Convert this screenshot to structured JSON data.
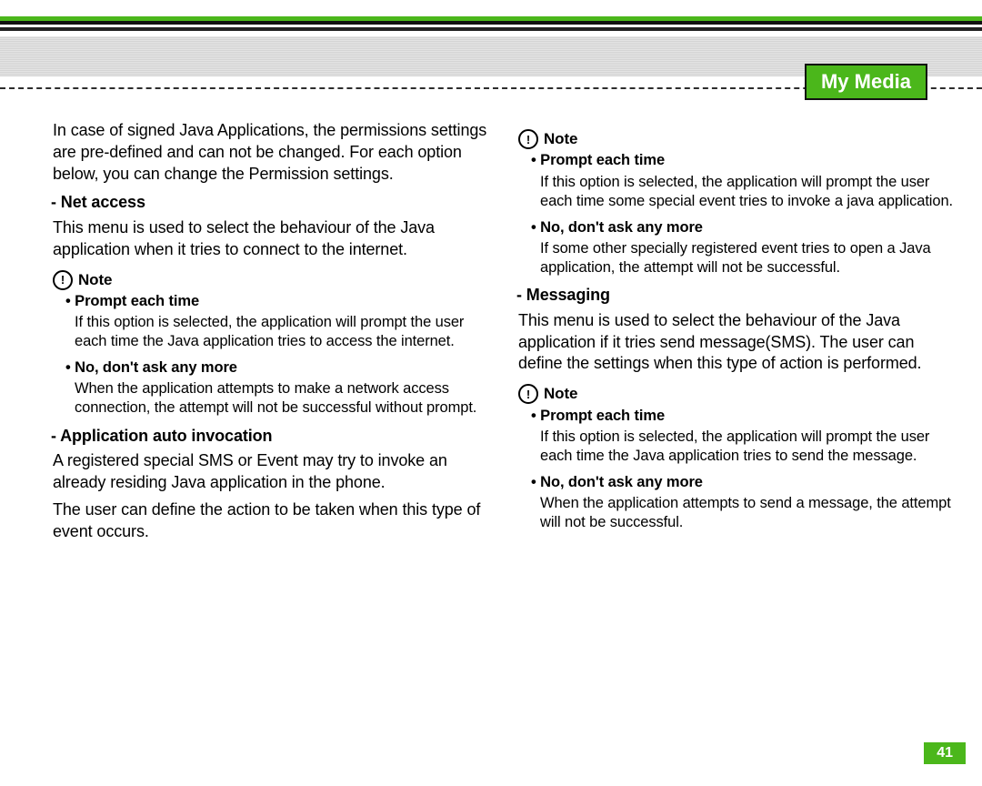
{
  "chapter": "My Media",
  "page_number": "41",
  "intro": "In case of signed Java Applications, the permissions settings are pre-defined and can not be changed. For each option below, you can change the Permission settings.",
  "sections": {
    "net_access": {
      "title": "Net access",
      "body": "This menu is used to select the behaviour of the Java application when it tries to connect to the internet.",
      "note_label": "Note",
      "items": [
        {
          "title": "Prompt each time",
          "body": "If this option is selected, the application will prompt the user each time the Java application tries to access the internet."
        },
        {
          "title": "No, don't ask any more",
          "body": "When the application attempts to make a network access connection, the attempt will not be successful without prompt."
        }
      ]
    },
    "auto_invocation": {
      "title": "Application auto invocation",
      "body1": "A registered special SMS or Event may try to invoke an already residing Java application in the phone.",
      "body2": "The user can define the action to be taken when this type of event occurs.",
      "note_label": "Note",
      "items": [
        {
          "title": "Prompt each time",
          "body": "If this option is selected, the application will prompt the user each time some special event tries to invoke a java application."
        },
        {
          "title": "No, don't ask any more",
          "body": "If some other specially registered event tries to open a Java application, the attempt will not be successful."
        }
      ]
    },
    "messaging": {
      "title": "Messaging",
      "body": "This menu is used to select the behaviour of the Java application if it tries send message(SMS). The user can define the settings when this type of action is performed.",
      "note_label": "Note",
      "items": [
        {
          "title": "Prompt each time",
          "body": "If this option is selected, the application will prompt the user each time the Java application tries to send the message."
        },
        {
          "title": "No, don't ask any more",
          "body": "When the application attempts to send a message, the attempt will not be successful."
        }
      ]
    }
  }
}
